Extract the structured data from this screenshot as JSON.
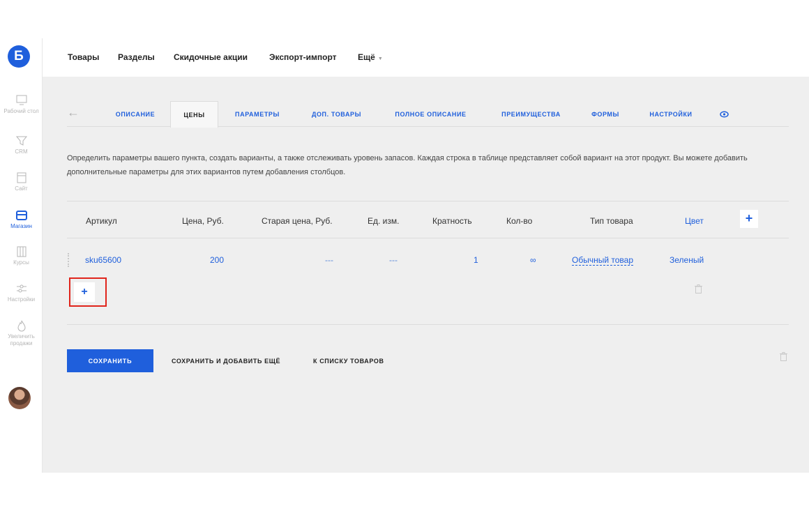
{
  "sidebar": {
    "logo": "Б",
    "items": [
      {
        "label": "Рабочий стол",
        "icon": "monitor-icon"
      },
      {
        "label": "CRM",
        "icon": "funnel-icon"
      },
      {
        "label": "Сайт",
        "icon": "site-icon"
      },
      {
        "label": "Магазин",
        "icon": "shop-icon",
        "active": true
      },
      {
        "label": "Курсы",
        "icon": "courses-icon"
      },
      {
        "label": "Настройки",
        "icon": "settings-icon"
      },
      {
        "label": "Увеличить продажи",
        "icon": "fire-icon"
      }
    ]
  },
  "topnav": {
    "items": [
      "Товары",
      "Разделы",
      "Скидочные акции",
      "Экспорт-импорт",
      "Ещё"
    ]
  },
  "tabs": [
    "ОПИСАНИЕ",
    "ЦЕНЫ",
    "ПАРАМЕТРЫ",
    "ДОП. ТОВАРЫ",
    "ПОЛНОЕ ОПИСАНИЕ",
    "ПРЕИМУЩЕСТВА",
    "ФОРМЫ",
    "НАСТРОЙКИ"
  ],
  "active_tab": "ЦЕНЫ",
  "description": "Определить параметры вашего пункта, создать варианты, а также отслеживать уровень запасов. Каждая строка в таблице представляет собой вариант на этот продукт. Вы можете добавить дополнительные параметры для этих вариантов путем добавления столбцов.",
  "table": {
    "headers": [
      "Артикул",
      "Цена, Руб.",
      "Старая цена, Руб.",
      "Ед. изм.",
      "Кратность",
      "Кол-во",
      "Тип товара",
      "Цвет"
    ],
    "add_column_label": "+",
    "rows": [
      [
        "sku65600",
        "200",
        "---",
        "---",
        "1",
        "∞",
        "Обычный товар",
        "Зеленый"
      ]
    ],
    "add_row_label": "+"
  },
  "actions": {
    "save": "СОХРАНИТЬ",
    "save_add": "СОХРАНИТЬ И ДОБАВИТЬ ЕЩЁ",
    "to_list": "К СПИСКУ ТОВАРОВ"
  }
}
